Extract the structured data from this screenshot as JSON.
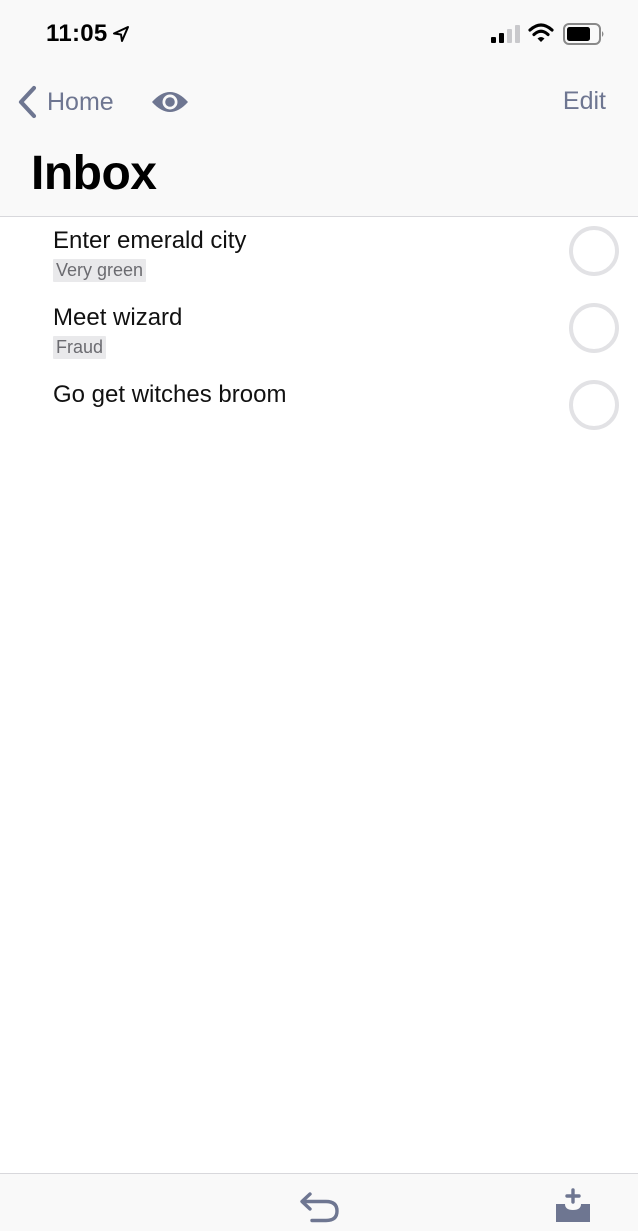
{
  "status_bar": {
    "time": "11:05",
    "icons": [
      "location-arrow-icon",
      "cellular-signal-icon",
      "wifi-icon",
      "battery-icon"
    ]
  },
  "nav": {
    "back_label": "Home",
    "back_icon": "chevron-left-icon",
    "view_icon": "eye-icon",
    "edit_label": "Edit"
  },
  "title": "Inbox",
  "tasks": [
    {
      "title": "Enter emerald city",
      "tag": "Very green",
      "completed": false
    },
    {
      "title": "Meet wizard",
      "tag": "Fraud",
      "completed": false
    },
    {
      "title": "Go get witches broom",
      "tag": "",
      "completed": false
    }
  ],
  "toolbar": {
    "undo_icon": "undo-arrow-icon",
    "add_icon": "inbox-add-icon"
  },
  "colors": {
    "accent": "#6e7691",
    "tag_background": "#e9e9eb",
    "checkbox_border": "#e2e2e5",
    "bar_background": "#f9f9f9"
  }
}
